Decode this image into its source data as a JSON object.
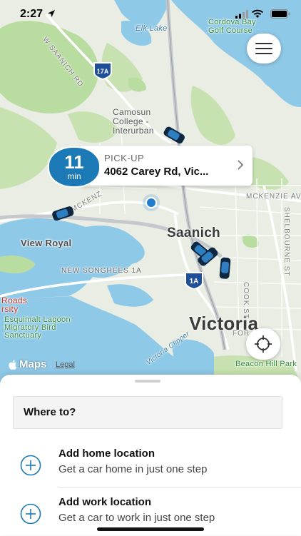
{
  "status_bar": {
    "time": "2:27",
    "icons": [
      "location-arrow-icon",
      "cellular-signal-icon",
      "wifi-icon",
      "battery-icon"
    ]
  },
  "map": {
    "labels": {
      "elk_lake": "Elk Lake",
      "cordova": "Cordova Bay",
      "cordova2": "Golf Course",
      "saanich_rd": "W SAANICH RD",
      "camosun1": "Camosun",
      "camosun2": "College -",
      "camosun3": "Interurban",
      "mckenzie_w": "MCKENZ",
      "mckenzie_e": "MCKENZIE AVE",
      "blenkinsop": "SHELBOURNE ST",
      "saanich": "Saanich",
      "view_royal": "View Royal",
      "songhees": "NEW SONGHEES 1A",
      "roads": "Roads",
      "rsity": "rsity",
      "esquimalt1": "Esquimalt Lagoon",
      "esquimalt2": "Migratory Bird",
      "esquimalt3": "Sanctuary",
      "victoria": "Victoria",
      "clipper": "Victoria Clipper",
      "cook_st": "COOK ST",
      "fort": "FOR",
      "beacon_hill": "Beacon Hill Park"
    },
    "shields": {
      "hwy17a": "17A",
      "hwy1a": "1A"
    },
    "attribution": {
      "brand": "Maps",
      "legal": "Legal"
    },
    "colors": {
      "land": "#e9ede3",
      "park": "#b9dca0",
      "water": "#8fc9e8",
      "road_major": "#ffffff",
      "highway": "#c5c8cc"
    }
  },
  "menu_button": {
    "icon": "hamburger-menu-icon"
  },
  "pickup": {
    "eta_value": "11",
    "eta_unit": "min",
    "label": "PICK-UP",
    "address": "4062 Carey Rd, Vic...",
    "badge_color": "#1b7ab5"
  },
  "locate_button": {
    "icon": "crosshair-locate-icon"
  },
  "sheet": {
    "search_placeholder": "Where to?",
    "locations": [
      {
        "title": "Add home location",
        "subtitle": "Get a car home in just one step",
        "icon": "plus-circle-icon"
      },
      {
        "title": "Add work location",
        "subtitle": "Get a car to work in just one step",
        "icon": "plus-circle-icon"
      }
    ],
    "accent": "#1b7ab5"
  }
}
